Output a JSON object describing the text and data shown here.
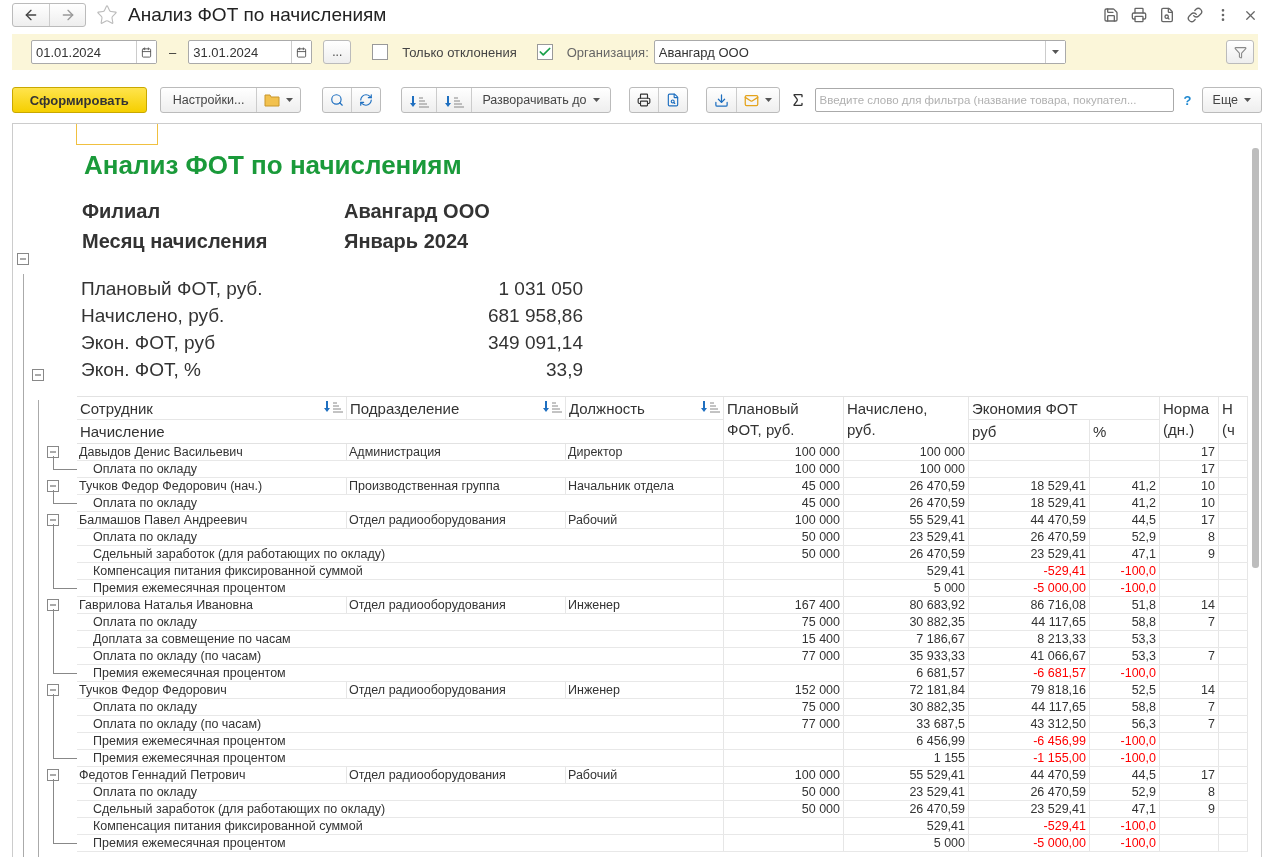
{
  "window": {
    "title": "Анализ ФОТ по начислениям",
    "favorite": false
  },
  "filters": {
    "date_from": "01.01.2024",
    "dash": "–",
    "date_to": "31.01.2024",
    "period_button": "...",
    "only_deviations": {
      "label": "Только отклонения",
      "checked": false
    },
    "organization": {
      "label": "Организация:",
      "checked": true,
      "value": "Авангард ООО"
    }
  },
  "toolbar": {
    "generate": "Сформировать",
    "settings": "Настройки...",
    "expand_to": "Разворачивать до",
    "search": {
      "placeholder": "Введите слово для фильтра (название товара, покупател..."
    },
    "help": "?",
    "more": "Еще"
  },
  "report": {
    "title": "Анализ ФОТ по начислениям",
    "expanded": true,
    "params": [
      {
        "label": "Филиал",
        "value": "Авангард ООО"
      },
      {
        "label": "Месяц начисления",
        "value": "Январь 2024"
      }
    ],
    "summary": [
      {
        "label": "Плановый ФОТ, руб.",
        "value": "1 031 050"
      },
      {
        "label": "Начислено, руб.",
        "value": "681 958,86"
      },
      {
        "label": "Экон. ФОТ, руб",
        "value": "349 091,14"
      },
      {
        "label": "Экон. ФОТ, %",
        "value": "33,9"
      }
    ],
    "table": {
      "expanded": true,
      "header": {
        "employee": "Сотрудник",
        "charge": "Начисление",
        "department": "Подразделение",
        "position": "Должность",
        "plan": "Плановый\nФОТ, руб.",
        "accrued": "Начислено,\nруб.",
        "economy": "Экономия ФОТ",
        "economy_rub": "руб",
        "economy_pct": "%",
        "norm": "Норма\n(дн.)",
        "column_10": "Н\n(ч"
      },
      "employees": [
        {
          "name": "Давыдов Денис Васильевич",
          "department": "Администрация",
          "position": "Директор",
          "plan": "100 000",
          "accrued": "100 000",
          "norm": "17",
          "expanded": true,
          "charges": [
            {
              "name": "Оплата по окладу",
              "plan": "100 000",
              "accrued": "100 000",
              "norm": "17",
              "negative": false
            }
          ]
        },
        {
          "name": "Тучков Федор Федорович (нач.)",
          "department": "Производственная группа",
          "position": "Начальник отдела",
          "plan": "45 000",
          "accrued": "26 470,59",
          "economy_rub": "18 529,41",
          "economy_pct": "41,2",
          "norm": "10",
          "expanded": true,
          "charges": [
            {
              "name": "Оплата по окладу",
              "plan": "45 000",
              "accrued": "26 470,59",
              "economy_rub": "18 529,41",
              "economy_pct": "41,2",
              "norm": "10",
              "negative": false
            }
          ]
        },
        {
          "name": "Балмашов Павел Андреевич",
          "department": "Отдел радиооборудования",
          "position": "Рабочий",
          "plan": "100 000",
          "accrued": "55 529,41",
          "economy_rub": "44 470,59",
          "economy_pct": "44,5",
          "norm": "17",
          "expanded": true,
          "charges": [
            {
              "name": "Оплата по окладу",
              "plan": "50 000",
              "accrued": "23 529,41",
              "economy_rub": "26 470,59",
              "economy_pct": "52,9",
              "norm": "8",
              "negative": false
            },
            {
              "name": "Сдельный заработок (для работающих по окладу)",
              "plan": "50 000",
              "accrued": "26 470,59",
              "economy_rub": "23 529,41",
              "economy_pct": "47,1",
              "norm": "9",
              "negative": false
            },
            {
              "name": "Компенсация питания фиксированной суммой",
              "accrued": "529,41",
              "economy_rub": "-529,41",
              "economy_pct": "-100,0",
              "negative": true
            },
            {
              "name": "Премия ежемесячная процентом",
              "accrued": "5 000",
              "economy_rub": "-5 000,00",
              "economy_pct": "-100,0",
              "negative": true
            }
          ]
        },
        {
          "name": "Гаврилова Наталья Ивановна",
          "department": "Отдел радиооборудования",
          "position": "Инженер",
          "plan": "167 400",
          "accrued": "80 683,92",
          "economy_rub": "86 716,08",
          "economy_pct": "51,8",
          "norm": "14",
          "expanded": true,
          "charges": [
            {
              "name": "Оплата по окладу",
              "plan": "75 000",
              "accrued": "30 882,35",
              "economy_rub": "44 117,65",
              "economy_pct": "58,8",
              "norm": "7",
              "negative": false
            },
            {
              "name": "Доплата за совмещение по часам",
              "plan": "15 400",
              "accrued": "7 186,67",
              "economy_rub": "8 213,33",
              "economy_pct": "53,3",
              "negative": false
            },
            {
              "name": "Оплата по окладу (по часам)",
              "plan": "77 000",
              "accrued": "35 933,33",
              "economy_rub": "41 066,67",
              "economy_pct": "53,3",
              "norm": "7",
              "negative": false
            },
            {
              "name": "Премия ежемесячная процентом",
              "accrued": "6 681,57",
              "economy_rub": "-6 681,57",
              "economy_pct": "-100,0",
              "negative": true
            }
          ]
        },
        {
          "name": "Тучков Федор Федорович",
          "department": "Отдел радиооборудования",
          "position": "Инженер",
          "plan": "152 000",
          "accrued": "72 181,84",
          "economy_rub": "79 818,16",
          "economy_pct": "52,5",
          "norm": "14",
          "expanded": true,
          "charges": [
            {
              "name": "Оплата по окладу",
              "plan": "75 000",
              "accrued": "30 882,35",
              "economy_rub": "44 117,65",
              "economy_pct": "58,8",
              "norm": "7",
              "negative": false
            },
            {
              "name": "Оплата по окладу (по часам)",
              "plan": "77 000",
              "accrued": "33 687,5",
              "economy_rub": "43 312,50",
              "economy_pct": "56,3",
              "norm": "7",
              "negative": false
            },
            {
              "name": "Премия ежемесячная процентом",
              "accrued": "6 456,99",
              "economy_rub": "-6 456,99",
              "economy_pct": "-100,0",
              "negative": true
            },
            {
              "name": "Премия ежемесячная процентом",
              "accrued": "1 155",
              "economy_rub": "-1 155,00",
              "economy_pct": "-100,0",
              "negative": true
            }
          ]
        },
        {
          "name": "Федотов Геннадий Петрович",
          "department": "Отдел радиооборудования",
          "position": "Рабочий",
          "plan": "100 000",
          "accrued": "55 529,41",
          "economy_rub": "44 470,59",
          "economy_pct": "44,5",
          "norm": "17",
          "expanded": true,
          "charges": [
            {
              "name": "Оплата по окладу",
              "plan": "50 000",
              "accrued": "23 529,41",
              "economy_rub": "26 470,59",
              "economy_pct": "52,9",
              "norm": "8",
              "negative": false
            },
            {
              "name": "Сдельный заработок (для работающих по окладу)",
              "plan": "50 000",
              "accrued": "26 470,59",
              "economy_rub": "23 529,41",
              "economy_pct": "47,1",
              "norm": "9",
              "negative": false
            },
            {
              "name": "Компенсация питания фиксированной суммой",
              "accrued": "529,41",
              "economy_rub": "-529,41",
              "economy_pct": "-100,0",
              "negative": true
            },
            {
              "name": "Премия ежемесячная процентом",
              "accrued": "5 000",
              "economy_rub": "-5 000,00",
              "economy_pct": "-100,0",
              "negative": true
            }
          ]
        }
      ]
    }
  }
}
